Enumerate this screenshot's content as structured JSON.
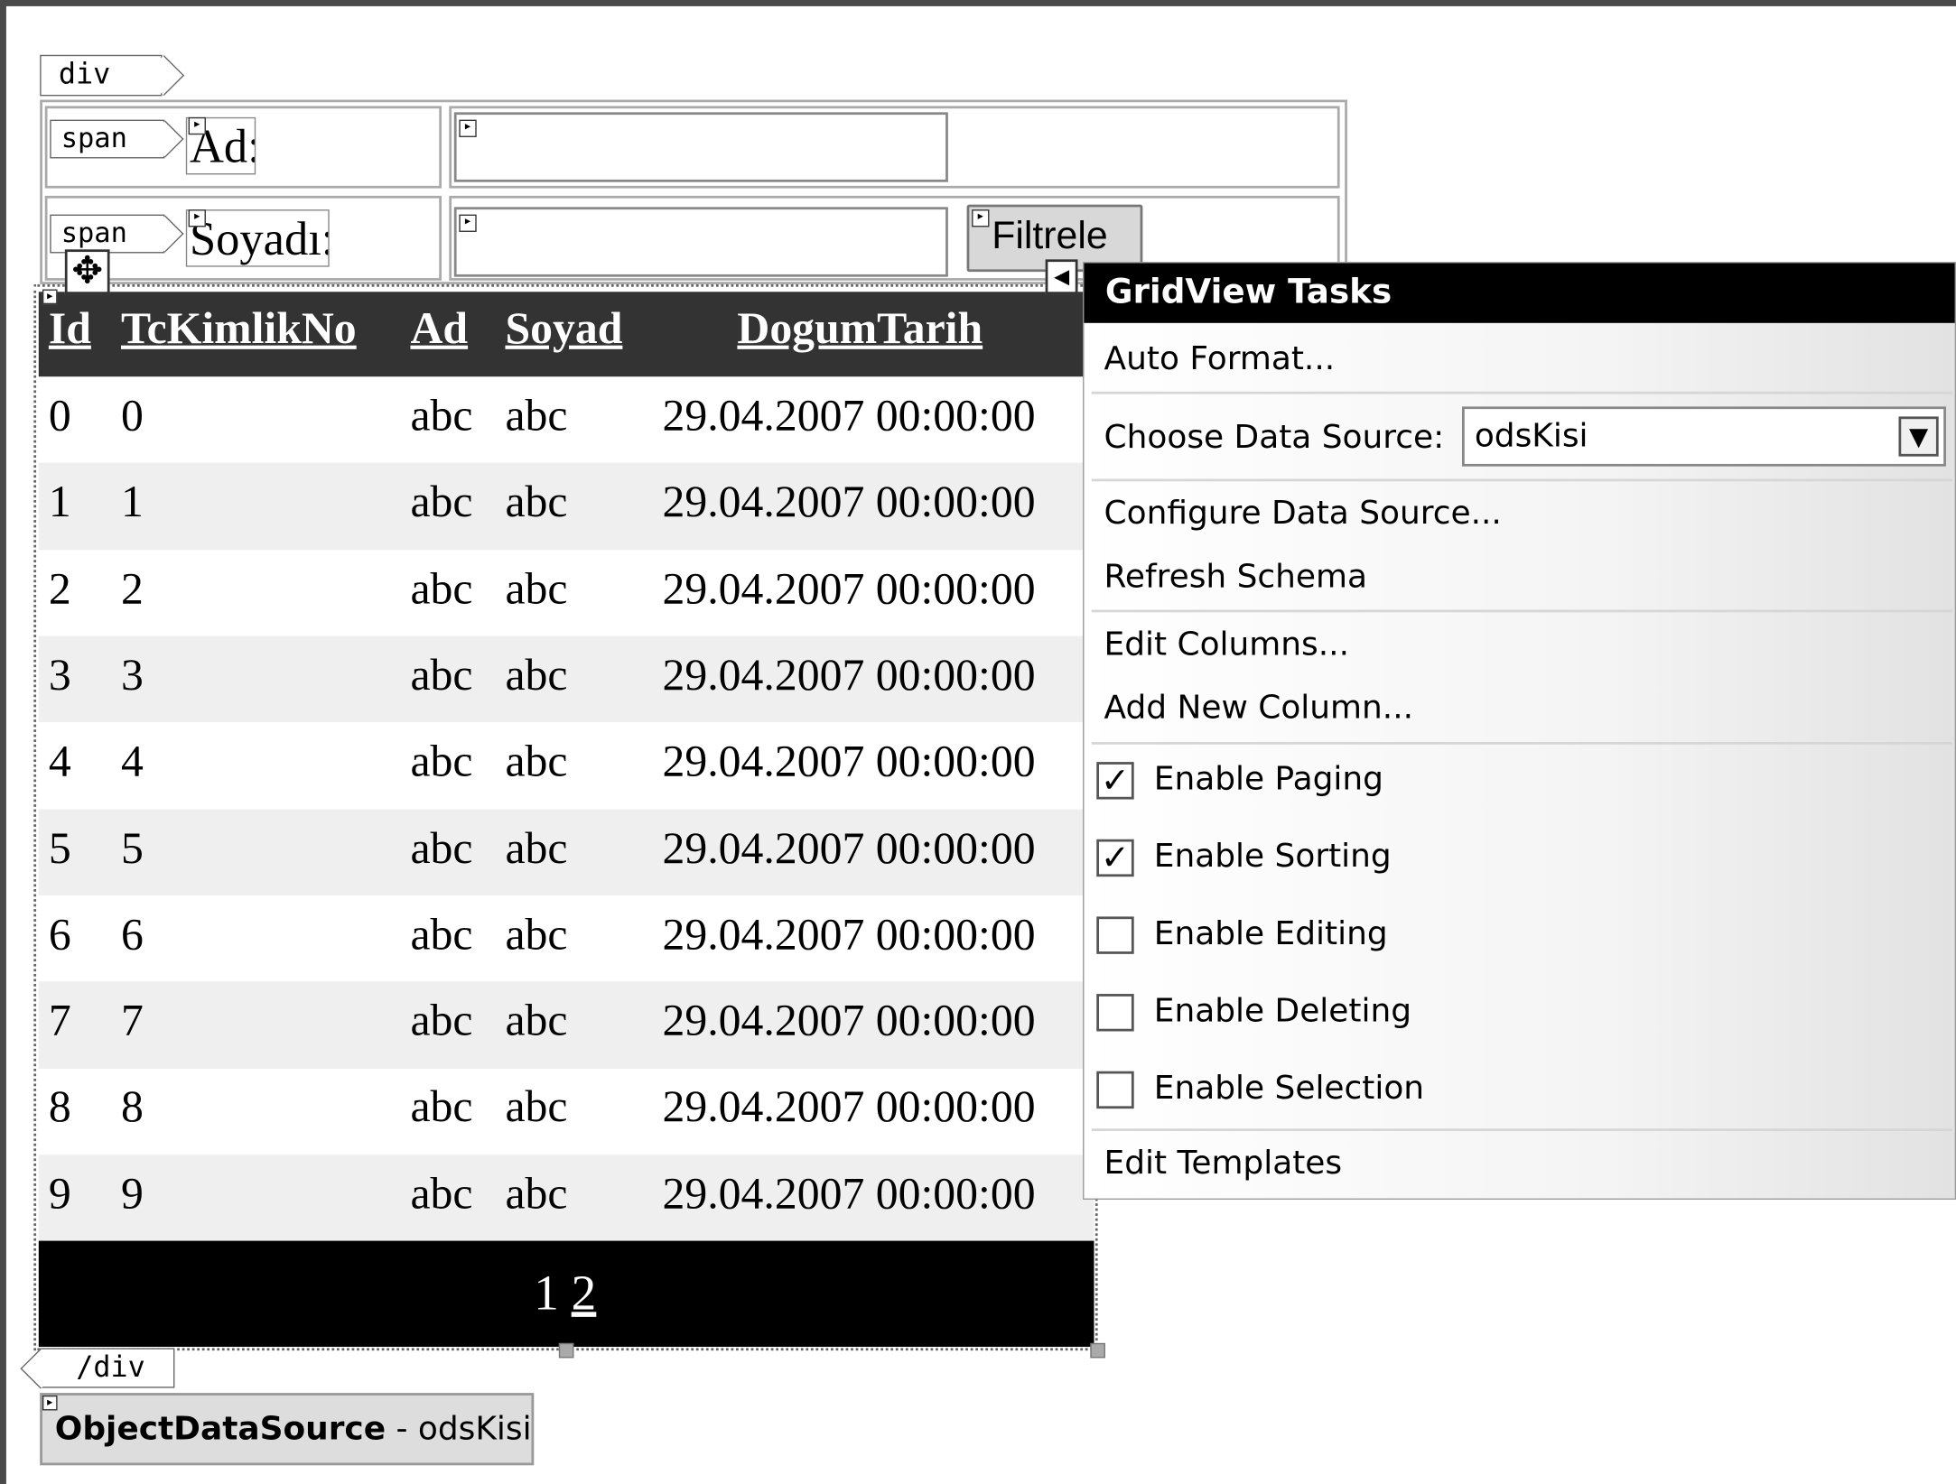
{
  "designer": {
    "div_open_tag": "div",
    "div_close_tag": "/div",
    "span_tag": "span"
  },
  "form": {
    "ad_label": "Ad:",
    "soyadi_label": "Soyadı:",
    "ad_input_value": "",
    "soyadi_input_value": "",
    "filter_button": "Filtrele"
  },
  "grid": {
    "columns": [
      "Id",
      "TcKimlikNo",
      "Ad",
      "Soyad",
      "DogumTarih"
    ],
    "rows": [
      [
        "0",
        "0",
        "abc",
        "abc",
        "29.04.2007 00:00:00"
      ],
      [
        "1",
        "1",
        "abc",
        "abc",
        "29.04.2007 00:00:00"
      ],
      [
        "2",
        "2",
        "abc",
        "abc",
        "29.04.2007 00:00:00"
      ],
      [
        "3",
        "3",
        "abc",
        "abc",
        "29.04.2007 00:00:00"
      ],
      [
        "4",
        "4",
        "abc",
        "abc",
        "29.04.2007 00:00:00"
      ],
      [
        "5",
        "5",
        "abc",
        "abc",
        "29.04.2007 00:00:00"
      ],
      [
        "6",
        "6",
        "abc",
        "abc",
        "29.04.2007 00:00:00"
      ],
      [
        "7",
        "7",
        "abc",
        "abc",
        "29.04.2007 00:00:00"
      ],
      [
        "8",
        "8",
        "abc",
        "abc",
        "29.04.2007 00:00:00"
      ],
      [
        "9",
        "9",
        "abc",
        "abc",
        "29.04.2007 00:00:00"
      ]
    ],
    "pager": [
      "1",
      "2"
    ]
  },
  "tasks": {
    "title": "GridView Tasks",
    "auto_format": "Auto Format...",
    "choose_data_source_label": "Choose Data Source:",
    "data_source_value": "odsKisi",
    "configure_data_source": "Configure Data Source...",
    "refresh_schema": "Refresh Schema",
    "edit_columns": "Edit Columns...",
    "add_new_column": "Add New Column...",
    "options": [
      {
        "label": "Enable Paging",
        "checked": true
      },
      {
        "label": "Enable Sorting",
        "checked": true
      },
      {
        "label": "Enable Editing",
        "checked": false
      },
      {
        "label": "Enable Deleting",
        "checked": false
      },
      {
        "label": "Enable Selection",
        "checked": false
      }
    ],
    "edit_templates": "Edit Templates"
  },
  "data_source_control": {
    "type": "ObjectDataSource",
    "separator": " - ",
    "id": "odsKisi"
  },
  "colors": {
    "header_bg": "#333333",
    "pager_bg": "#000000",
    "alt_row_bg": "#efefef",
    "tasks_title_bg": "#000000"
  }
}
